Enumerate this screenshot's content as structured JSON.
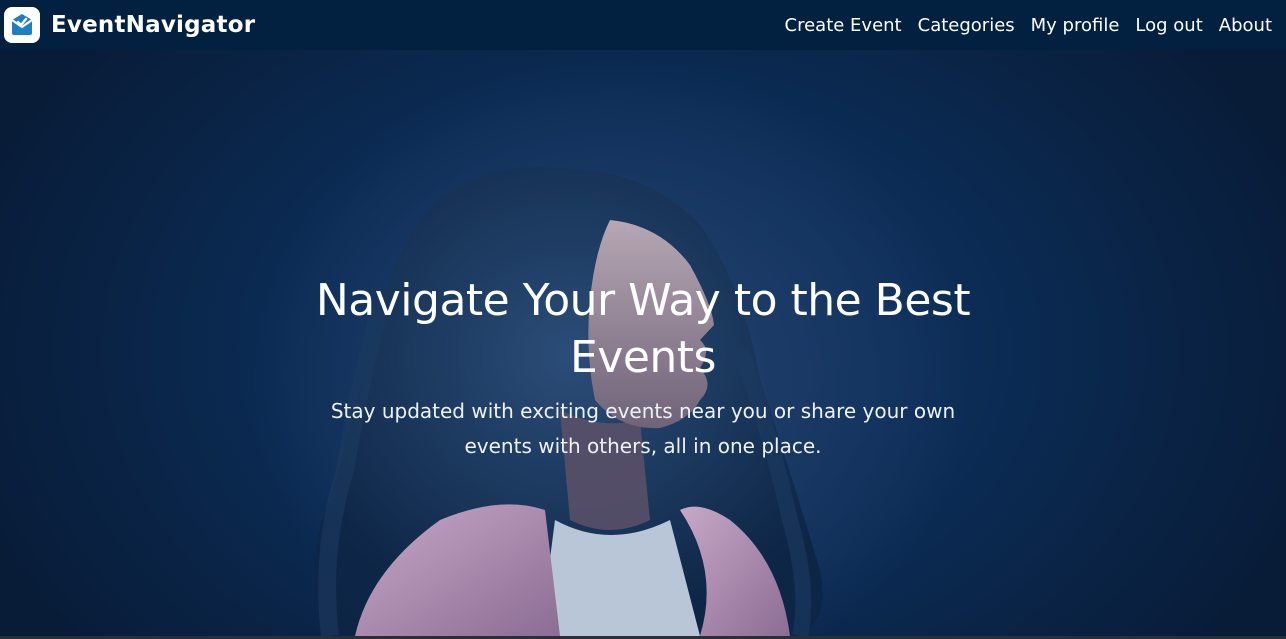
{
  "nav": {
    "brand": "EventNavigator",
    "logo_icon": "envelope-check-icon",
    "links": [
      "Create Event",
      "Categories",
      "My profile",
      "Log out",
      "About"
    ]
  },
  "hero": {
    "title": "Navigate Your Way to the Best Events",
    "subtitle": "Stay updated with exciting events near you or share your own events with others, all in one place.",
    "image": "woman-looking-up-photo"
  },
  "colors": {
    "navbar": "#02203f",
    "hero_background": "#0b2a52",
    "logo_accent": "#2a8fd6",
    "text": "#ffffff"
  }
}
